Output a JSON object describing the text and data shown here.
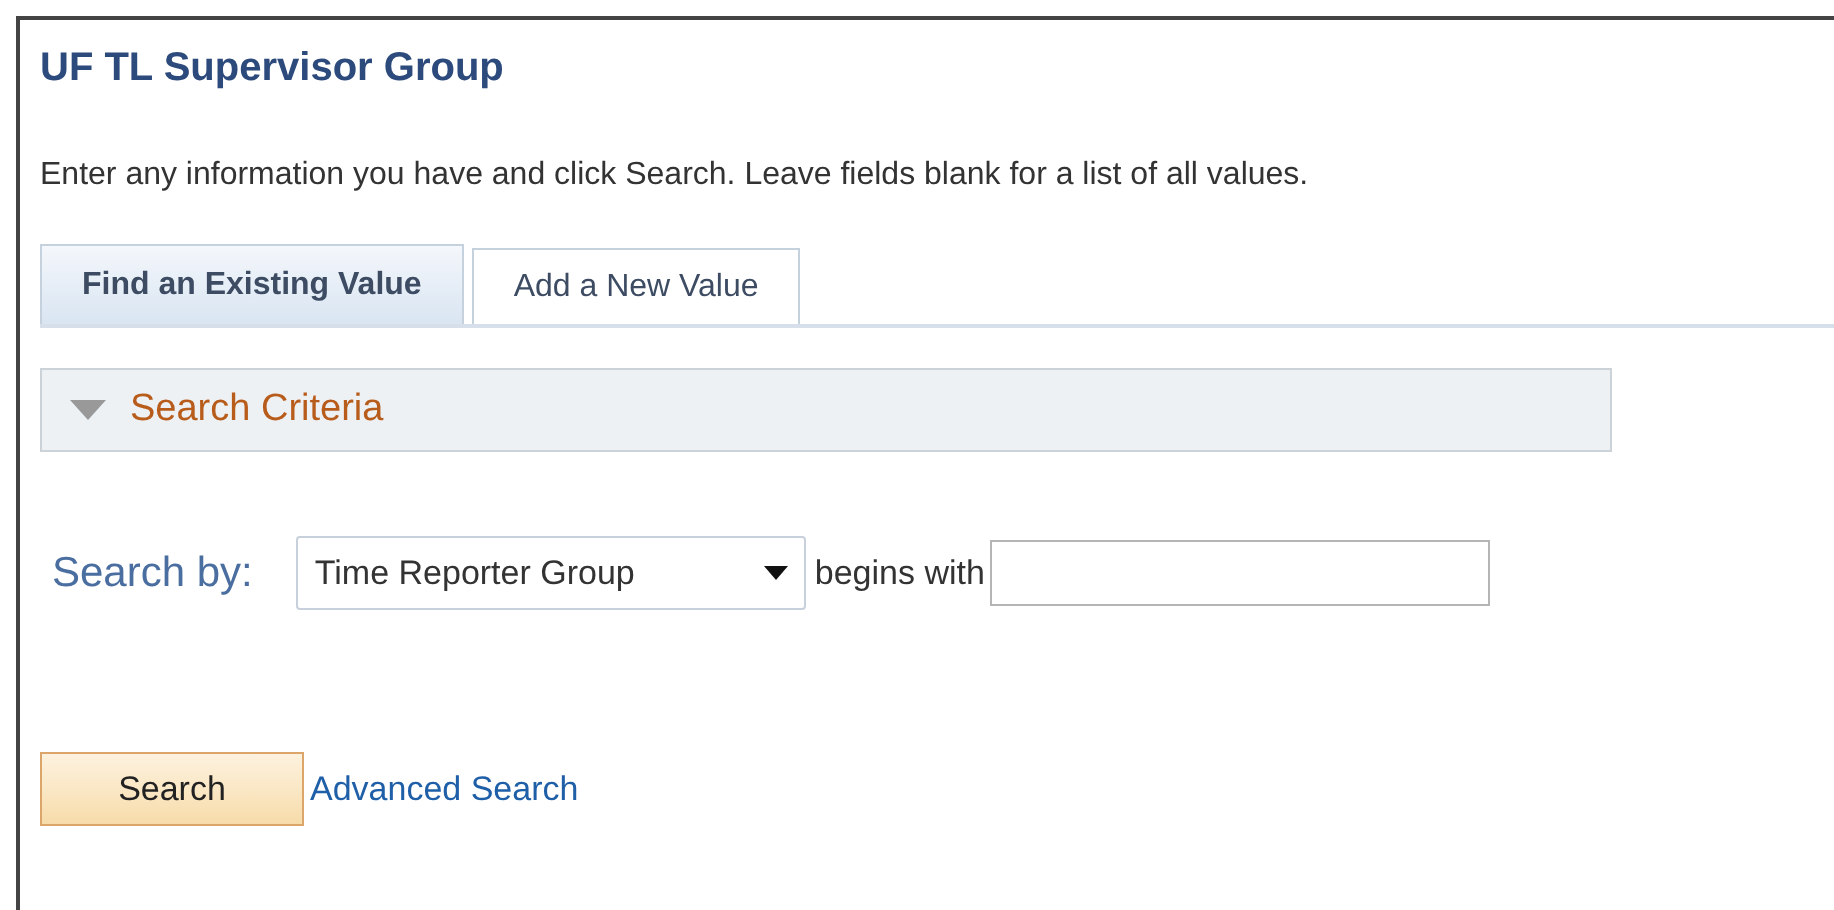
{
  "page": {
    "title": "UF TL Supervisor Group",
    "instructions": "Enter any information you have and click Search. Leave fields blank for a list of all values."
  },
  "tabs": [
    {
      "label": "Find an Existing Value",
      "selected": true
    },
    {
      "label": "Add a New Value",
      "selected": false
    }
  ],
  "section": {
    "title": "Search Criteria",
    "expanded": true
  },
  "search_row": {
    "label": "Search by:",
    "field": "Time Reporter Group",
    "operator": "begins with"
  },
  "buttons": {
    "search": "Search",
    "advanced_link": "Advanced Search"
  }
}
